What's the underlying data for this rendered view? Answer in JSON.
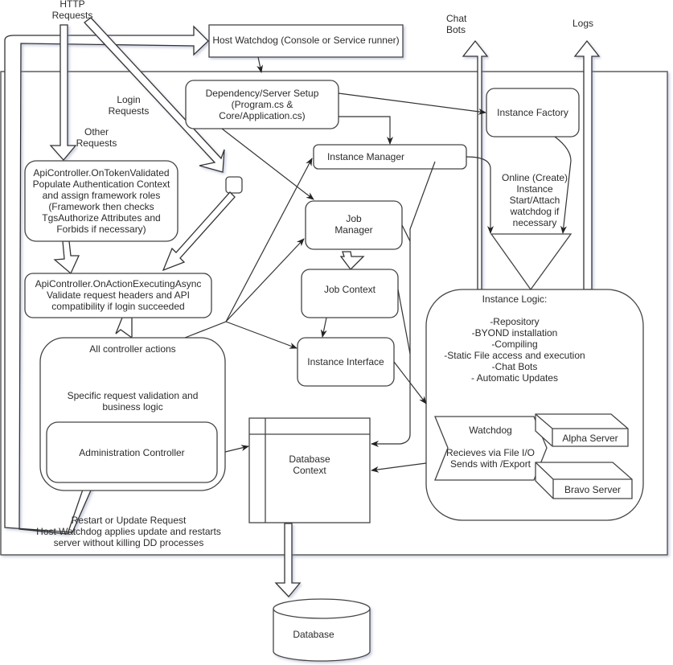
{
  "diagram": {
    "external": {
      "http_requests": "HTTP\nRequests",
      "chat_bots": "Chat\nBots",
      "logs": "Logs"
    },
    "edge_labels": {
      "login_requests": "Login\nRequests",
      "other_requests": "Other\nRequests",
      "online_create": "Online (Create)\nInstance\nStart/Attach\nwatchdog if\nnecessary",
      "restart_update": "Restart or Update Request\nHost Watchdog applies update and restarts\nserver without killing DD processes"
    },
    "nodes": {
      "host_watchdog": "Host Watchdog (Console or Service runner)",
      "dependency_setup": "Dependency/Server Setup\n(Program.cs &\nCore/Application.cs)",
      "instance_factory": "Instance Factory",
      "instance_manager": "Instance Manager",
      "on_token_validated": "ApiController.OnTokenValidated\nPopulate Authentication Context\nand assign framework roles\n(Framework then checks\nTgsAuthorize Attributes and\nForbids if necessary)",
      "on_action_executing": "ApiController.OnActionExecutingAsync\nValidate request headers and API\ncompatibility if login succeeded",
      "job_manager": "Job\nManager",
      "job_context": "Job Context",
      "instance_interface": "Instance Interface",
      "all_controller_actions": "All controller actions",
      "specific_validation": "Specific request validation and\nbusiness logic",
      "administration_controller": "Administration Controller",
      "database_context": "Database\nContext",
      "database": "Database",
      "instance_logic": "Instance Logic:\n\n-Repository\n-BYOND installation\n-Compiling\n-Static File access and execution\n-Chat Bots\n- Automatic Updates",
      "watchdog": "Watchdog\n\nRecieves via File I/O\nSends with /Export",
      "alpha_server": "Alpha Server",
      "bravo_server": "Bravo Server"
    }
  }
}
